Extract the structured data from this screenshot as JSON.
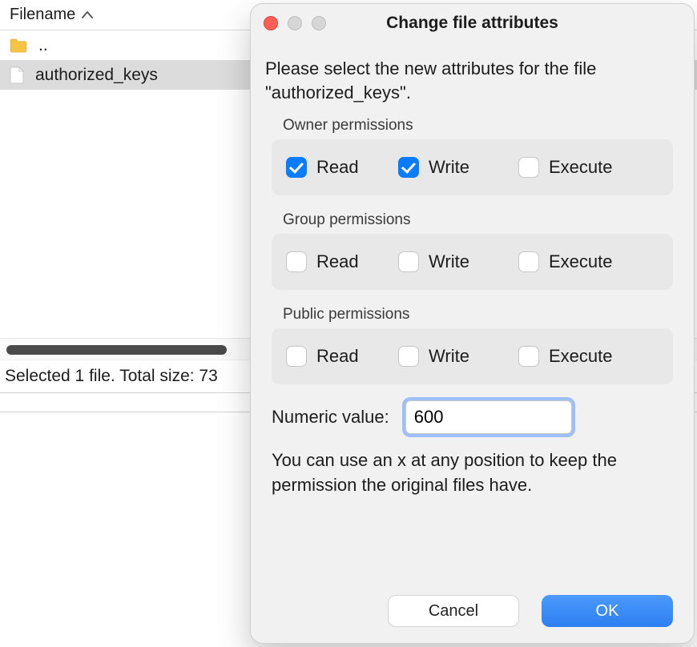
{
  "file_panel": {
    "header_label": "Filename",
    "rows": {
      "parent_label": "..",
      "selected_label": "authorized_keys"
    },
    "status_text": "Selected 1 file. Total size: 73"
  },
  "dialog": {
    "title": "Change file attributes",
    "intro": "Please select the new attributes for the file \"authorized_keys\".",
    "owner_label": "Owner permissions",
    "group_label": "Group permissions",
    "public_label": "Public permissions",
    "perm_read": "Read",
    "perm_write": "Write",
    "perm_execute": "Execute",
    "owner": {
      "read": true,
      "write": true,
      "execute": false
    },
    "group": {
      "read": false,
      "write": false,
      "execute": false
    },
    "public": {
      "read": false,
      "write": false,
      "execute": false
    },
    "numeric_label": "Numeric value:",
    "numeric_value": "600",
    "hint": "You can use an x at any position to keep the permission the original files have.",
    "cancel_label": "Cancel",
    "ok_label": "OK"
  }
}
